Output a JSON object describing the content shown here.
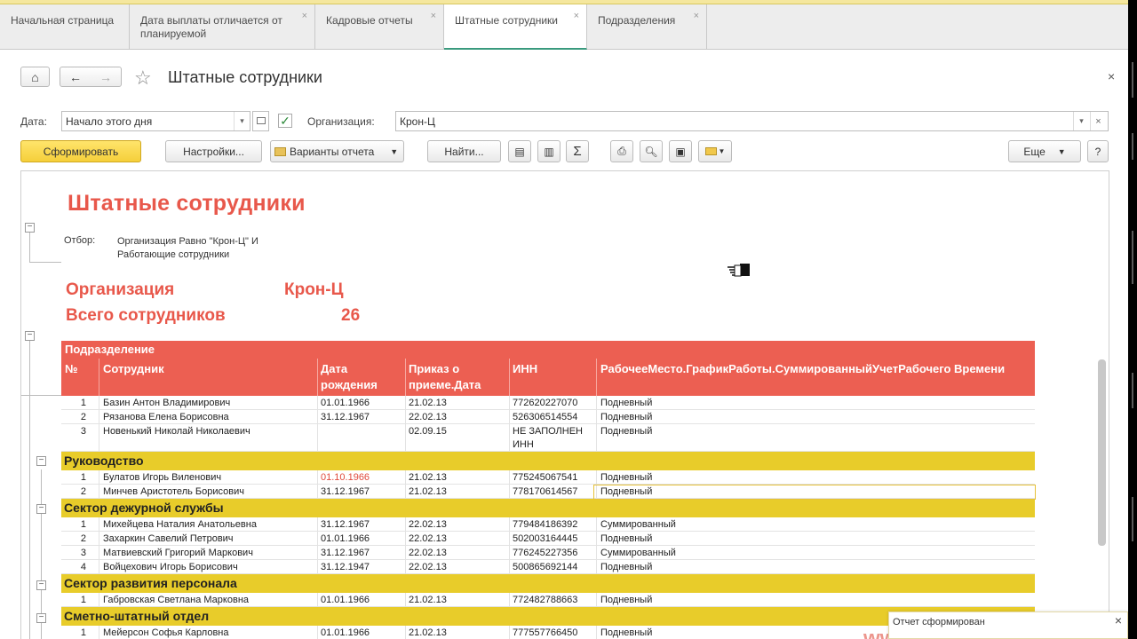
{
  "tabs": [
    {
      "label": "Начальная страница",
      "closable": false
    },
    {
      "label": "Дата выплаты отличается от планируемой",
      "closable": true
    },
    {
      "label": "Кадровые отчеты",
      "closable": true
    },
    {
      "label": "Штатные сотрудники",
      "closable": true,
      "active": true
    },
    {
      "label": "Подразделения",
      "closable": true
    }
  ],
  "header": {
    "title": "Штатные сотрудники"
  },
  "filters": {
    "date_label": "Дата:",
    "date_value": "Начало этого дня",
    "org_label": "Организация:",
    "org_value": "Крон-Ц",
    "org_checked": true
  },
  "toolbar": {
    "generate": "Сформировать",
    "settings": "Настройки...",
    "variants": "Варианты отчета",
    "find": "Найти...",
    "more": "Еще",
    "help": "?"
  },
  "report": {
    "title": "Штатные сотрудники",
    "filter_label": "Отбор:",
    "filter_value": "Организация Равно \"Крон-Ц\" И Работающие сотрудники",
    "org_label": "Организация",
    "org_value": "Крон-Ц",
    "total_label": "Всего сотрудников",
    "total_value": "26",
    "table": {
      "group_header": "Подразделение",
      "columns": [
        "№",
        "Сотрудник",
        "Дата рождения",
        "Приказ о приеме.Дата",
        "ИНН",
        "РабочееМесто.ГрафикРаботы.СуммированныйУчетРабочего Времени"
      ],
      "ungrouped_rows": [
        [
          "1",
          "Базин Антон Владимирович",
          "01.01.1966",
          "21.02.13",
          "772620227070",
          "Подневный"
        ],
        [
          "2",
          "Рязанова Елена Борисовна",
          "31.12.1967",
          "22.02.13",
          "526306514554",
          "Подневный"
        ],
        [
          "3",
          "Новенький Николай Николаевич",
          "",
          "02.09.15",
          "НЕ ЗАПОЛНЕН ИНН",
          "Подневный"
        ]
      ],
      "groups": [
        {
          "name": "Руководство",
          "rows": [
            [
              "1",
              "Булатов Игорь Виленович",
              "01.10.1966",
              "21.02.13",
              "775245067541",
              "Подневный"
            ],
            [
              "2",
              "Минчев Аристотель Борисович",
              "31.12.1967",
              "21.02.13",
              "778170614567",
              "Подневный"
            ]
          ]
        },
        {
          "name": "Сектор дежурной службы",
          "rows": [
            [
              "1",
              "Михейцева Наталия Анатольевна",
              "31.12.1967",
              "22.02.13",
              "779484186392",
              "Суммированный"
            ],
            [
              "2",
              "Захаркин Савелий Петрович",
              "01.01.1966",
              "22.02.13",
              "502003164445",
              "Подневный"
            ],
            [
              "3",
              "Матвиевский Григорий Маркович",
              "31.12.1967",
              "22.02.13",
              "776245227356",
              "Суммированный"
            ],
            [
              "4",
              "Войцехович Игорь Борисович",
              "31.12.1947",
              "22.02.13",
              "500865692144",
              "Подневный"
            ]
          ]
        },
        {
          "name": "Сектор развития персонала",
          "rows": [
            [
              "1",
              "Габровская Светлана Марковна",
              "01.01.1966",
              "21.02.13",
              "772482788663",
              "Подневный"
            ]
          ]
        },
        {
          "name": "Сметно-штатный отдел",
          "rows": [
            [
              "1",
              "Мейерсон Софья Карловна",
              "01.01.1966",
              "21.02.13",
              "777557766450",
              "Подневный"
            ]
          ]
        }
      ]
    }
  },
  "status": {
    "message": "Отчет сформирован"
  },
  "colors": {
    "accent_red": "#e8584b",
    "group_yellow": "#e8cc2a",
    "primary_button": "#f5cf3a"
  }
}
